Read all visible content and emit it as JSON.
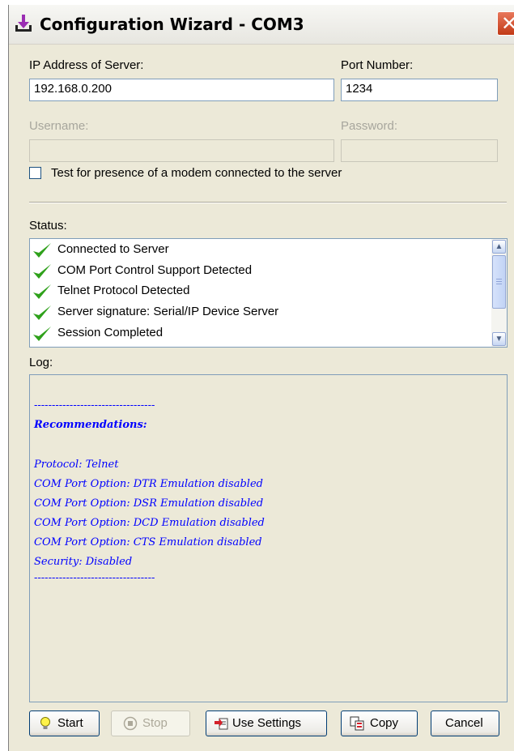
{
  "window": {
    "title": "Configuration Wizard - COM3"
  },
  "server": {
    "ip_label": "IP Address of Server:",
    "ip_value": "192.168.0.200",
    "port_label": "Port Number:",
    "port_value": "1234",
    "username_label": "Username:",
    "username_value": "",
    "password_label": "Password:",
    "password_value": ""
  },
  "modem_check": {
    "label": "Test for presence of a modem connected to the server",
    "checked": false
  },
  "status": {
    "label": "Status:",
    "items": [
      "Connected to Server",
      "COM Port Control Support Detected",
      "Telnet Protocol Detected",
      "Server signature: Serial/IP Device Server",
      "Session Completed"
    ]
  },
  "log": {
    "label": "Log:",
    "lines": [
      "----------------------------------",
      "Recommendations:",
      "",
      "Protocol: Telnet",
      "COM Port Option: DTR Emulation disabled",
      "COM Port Option: DSR Emulation disabled",
      "COM Port Option: DCD Emulation disabled",
      "COM Port Option: CTS Emulation disabled",
      "Security: Disabled",
      "----------------------------------"
    ]
  },
  "buttons": {
    "start": "Start",
    "stop": "Stop",
    "use_settings": "Use Settings",
    "copy": "Copy",
    "cancel": "Cancel"
  },
  "colors": {
    "log_text": "#0000ff",
    "check": "#2fa11b",
    "window_bg": "#ECE9D8"
  }
}
